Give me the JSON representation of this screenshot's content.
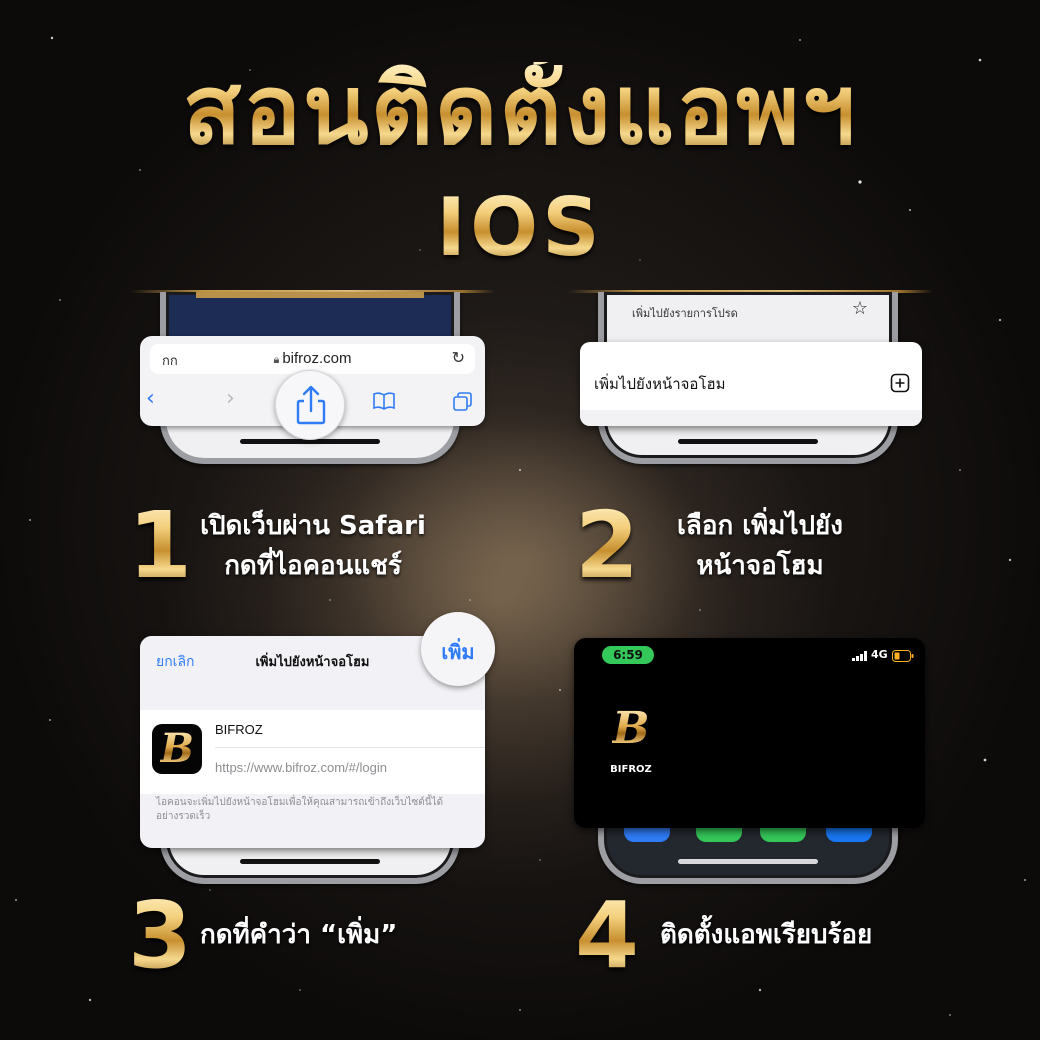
{
  "header": {
    "title": "สอนติดตั้งแอพฯ",
    "subtitle": "IOS"
  },
  "step1": {
    "number": "1",
    "caption_line1": "เปิดเว็บผ่าน Safari",
    "caption_line2": "กดที่ไอคอนแชร์",
    "safari": {
      "text_size_label": "กก",
      "url": "bifroz.com"
    }
  },
  "step2": {
    "number": "2",
    "caption_line1": "เลือก เพิ่มไปยัง",
    "caption_line2": "หน้าจอโฮม",
    "menu": {
      "favorites_label": "เพิ่มไปยังรายการโปรด",
      "add_home_label": "เพิ่มไปยังหน้าจอโฮม"
    }
  },
  "step3": {
    "number": "3",
    "caption": "กดที่คำว่า “เพิ่ม”",
    "sheet": {
      "cancel_label": "ยกเลิก",
      "title": "เพิ่มไปยังหน้าจอโฮม",
      "add_label": "เพิ่ม",
      "app_name": "BIFROZ",
      "app_url": "https://www.bifroz.com/#/login",
      "note": "ไอคอนจะเพิ่มไปยังหน้าจอโฮมเพื่อให้คุณสามารถเข้าถึงเว็บไซต์นี้ได้อย่างรวดเร็ว"
    }
  },
  "step4": {
    "number": "4",
    "caption": "ติดตั้งแอพเรียบร้อย",
    "status": {
      "time": "6:59",
      "network": "4G"
    },
    "app_label": "BIFROZ"
  },
  "colors": {
    "ios_blue": "#2f7cf6",
    "gold": "#e0b25c",
    "status_green": "#34c759"
  },
  "icons": [
    "share-icon",
    "back-chevron-icon",
    "forward-chevron-icon",
    "bookmarks-icon",
    "tabs-icon",
    "reload-icon",
    "lock-icon",
    "star-icon",
    "plus-square-icon",
    "signal-icon",
    "battery-icon"
  ]
}
